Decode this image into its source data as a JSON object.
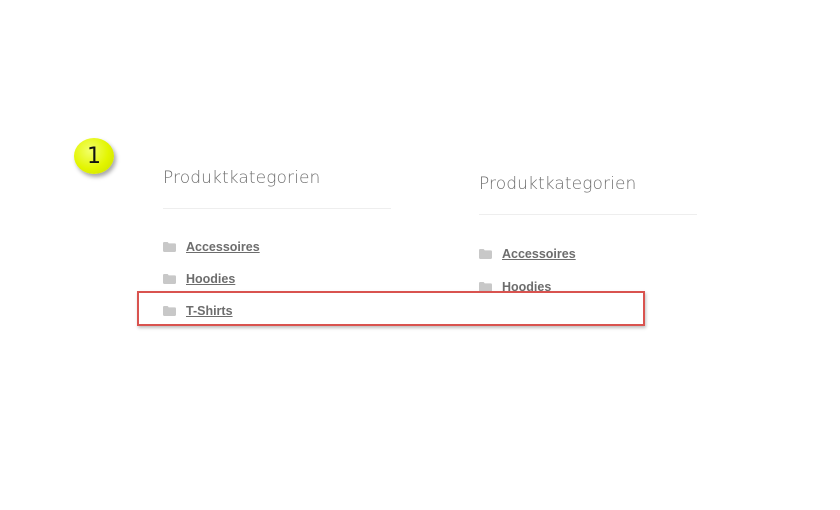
{
  "step_marker": {
    "number": "1"
  },
  "widgets": [
    {
      "title": "Produktkategorien",
      "items": [
        {
          "label": "Accessoires",
          "icon": "folder-icon"
        },
        {
          "label": "Hoodies",
          "icon": "folder-icon"
        },
        {
          "label": "T-Shirts",
          "icon": "folder-icon"
        }
      ]
    },
    {
      "title": "Produktkategorien",
      "items": [
        {
          "label": "Accessoires",
          "icon": "folder-icon"
        },
        {
          "label": "Hoodies",
          "icon": "folder-icon"
        }
      ]
    }
  ],
  "colors": {
    "highlight_border": "#d9534f",
    "marker_fill": "#e3f500",
    "link_text": "#6d6d6d",
    "folder_icon": "#c8c8c8"
  }
}
